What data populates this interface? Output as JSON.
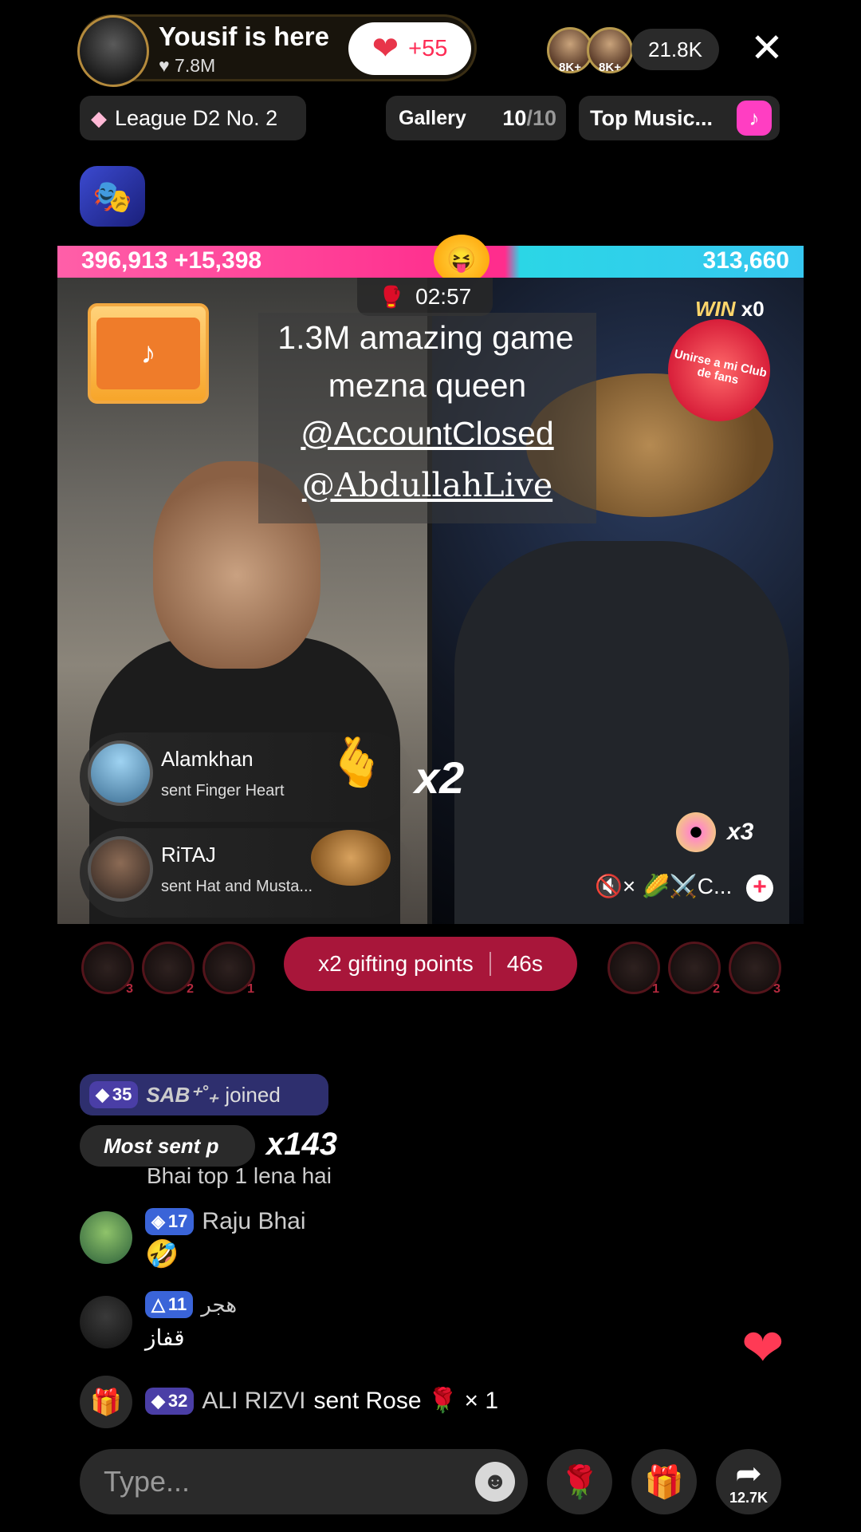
{
  "header": {
    "host_name": "Yousif is here",
    "host_likes": "7.8M",
    "like_gain": "+55",
    "viewer_badges": [
      "8K+",
      "8K+"
    ],
    "viewer_count": "21.8K",
    "close_label": "✕"
  },
  "pills": {
    "league": "League D2 No. 2",
    "gallery_label": "Gallery",
    "gallery_count_current": "10",
    "gallery_count_total": "/10",
    "music_label": "Top Music..."
  },
  "battle": {
    "score_left": "396,913",
    "score_left_increment": "+15,398",
    "score_right": "313,660",
    "timer": "02:57",
    "win_label": "WIN",
    "win_count": "x0",
    "fan_club_badge": "Unirse a mi Club de fans",
    "overlay_lines": [
      "1.3M amazing game",
      "mezna queen",
      "@AccountClosed",
      "@AbdullahLive"
    ]
  },
  "gifts": {
    "toasts": [
      {
        "name": "Alamkhan",
        "message": "sent Finger Heart"
      },
      {
        "name": "RiTAJ",
        "message": "sent Hat and Musta..."
      }
    ],
    "combo": "x2",
    "right_gift_count": "x3",
    "right_ticker": "🔇× 🌽⚔️C..."
  },
  "supporters": {
    "left_ranks": [
      "3",
      "2",
      "1"
    ],
    "right_ranks": [
      "1",
      "2",
      "3"
    ],
    "gifting_label": "x2 gifting points",
    "gifting_time": "46s"
  },
  "chat": {
    "joined": {
      "level": "35",
      "name": "SAB⁺˚₊",
      "action": "joined"
    },
    "most_sent_label": "Most sent p",
    "most_sent_count": "x143",
    "partial_message": "Bhai top 1 lena hai",
    "messages": [
      {
        "level": "17",
        "name": "Raju Bhai",
        "text": "🤣"
      },
      {
        "level": "11",
        "name": "هجر",
        "text": "قفاز"
      }
    ],
    "gift_log": {
      "level": "32",
      "user": "ALI RIZVI",
      "action": "sent Rose 🌹 × 1"
    }
  },
  "bottom_bar": {
    "input_placeholder": "Type...",
    "share_count": "12.7K"
  },
  "colors": {
    "accent": "#fe2c55",
    "score_left": "#ff2d8d",
    "score_right": "#36c7f0",
    "gifting_pill": "#a8163a"
  }
}
